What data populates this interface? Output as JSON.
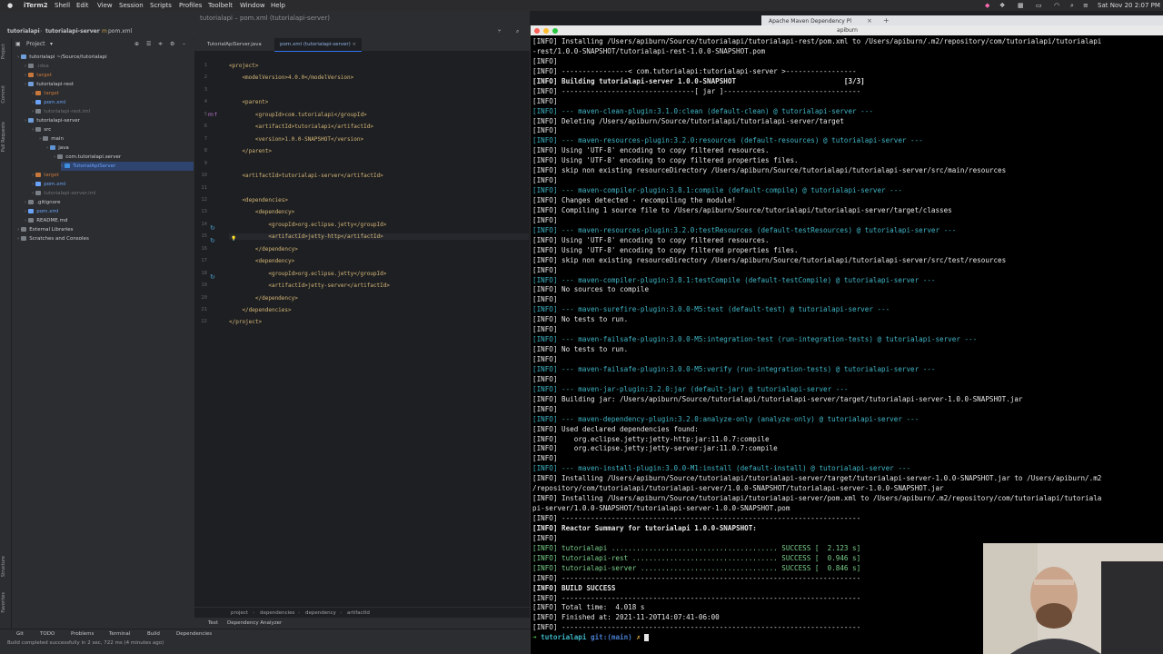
{
  "menubar": {
    "app": "iTerm2",
    "items": [
      "Shell",
      "Edit",
      "View",
      "Session",
      "Scripts",
      "Profiles",
      "Toolbelt",
      "Window",
      "Help"
    ],
    "clock": "Sat Nov 20  2:07 PM"
  },
  "ide": {
    "window_title": "tutorialapi – pom.xml (tutorialapi-server)",
    "breadcrumb": [
      "tutorialapi",
      "tutorialapi-server",
      "pom.xml"
    ],
    "project_label": "Project",
    "tree": [
      {
        "label": "tutorialapi ~/Source/tutorialapi",
        "indent": 0,
        "color": "#c9ccd1",
        "icon": "#6f9ed8"
      },
      {
        "label": ".idea",
        "indent": 1,
        "color": "#6e7278",
        "icon": "#7a7e85"
      },
      {
        "label": "target",
        "indent": 1,
        "color": "#c7773b",
        "icon": "#c7773b"
      },
      {
        "label": "tutorialapi-rest",
        "indent": 1,
        "color": "#c9ccd1",
        "icon": "#6f9ed8"
      },
      {
        "label": "target",
        "indent": 2,
        "color": "#c7773b",
        "icon": "#c7773b"
      },
      {
        "label": "pom.xml",
        "indent": 2,
        "color": "#6aa3f8",
        "icon": "#6aa3f8"
      },
      {
        "label": "tutorialapi-rest.iml",
        "indent": 2,
        "color": "#6e7278",
        "icon": "#7a7e85"
      },
      {
        "label": "tutorialapi-server",
        "indent": 1,
        "color": "#c9ccd1",
        "icon": "#6f9ed8"
      },
      {
        "label": "src",
        "indent": 2,
        "color": "#c9ccd1",
        "icon": "#7a7e85"
      },
      {
        "label": "main",
        "indent": 3,
        "color": "#c9ccd1",
        "icon": "#7a7e85"
      },
      {
        "label": "java",
        "indent": 4,
        "color": "#c9ccd1",
        "icon": "#5f93d1"
      },
      {
        "label": "com.tutorialapi.server",
        "indent": 5,
        "color": "#c9ccd1",
        "icon": "#7a7e85"
      },
      {
        "label": "TutorialApiServer",
        "indent": 6,
        "color": "#6aa3f8",
        "icon": "#3f8fe0"
      },
      {
        "label": "target",
        "indent": 2,
        "color": "#c7773b",
        "icon": "#c7773b"
      },
      {
        "label": "pom.xml",
        "indent": 2,
        "color": "#6aa3f8",
        "icon": "#6aa3f8"
      },
      {
        "label": "tutorialapi-server.iml",
        "indent": 2,
        "color": "#6e7278",
        "icon": "#7a7e85"
      },
      {
        "label": ".gitignore",
        "indent": 1,
        "color": "#c9ccd1",
        "icon": "#7a7e85"
      },
      {
        "label": "pom.xml",
        "indent": 1,
        "color": "#6aa3f8",
        "icon": "#6aa3f8"
      },
      {
        "label": "README.md",
        "indent": 1,
        "color": "#c9ccd1",
        "icon": "#7a7e85"
      },
      {
        "label": "External Libraries",
        "indent": 0,
        "color": "#c9ccd1",
        "icon": "#7a7e85"
      },
      {
        "label": "Scratches and Consoles",
        "indent": 0,
        "color": "#c9ccd1",
        "icon": "#7a7e85"
      }
    ],
    "tabs": [
      "TutorialApiServer.java",
      "pom.xml (tutorialapi-server)"
    ],
    "line_numbers": [
      "1",
      "2",
      "3",
      "4",
      "5",
      "6",
      "7",
      "8",
      "9",
      "10",
      "11",
      "12",
      "13",
      "14",
      "15",
      "16",
      "17",
      "18",
      "19",
      "20",
      "21",
      "22"
    ],
    "code": [
      "<project>",
      "    <modelVersion>4.0.0</modelVersion>",
      "",
      "    <parent>",
      "        <groupId>com.tutorialapi</groupId>",
      "        <artifactId>tutorialapi</artifactId>",
      "        <version>1.0.0-SNAPSHOT</version>",
      "    </parent>",
      "",
      "    <artifactId>tutorialapi-server</artifactId>",
      "",
      "    <dependencies>",
      "        <dependency>",
      "            <groupId>org.eclipse.jetty</groupId>",
      "            <artifactId>jetty-http</artifactId>",
      "        </dependency>",
      "        <dependency>",
      "            <groupId>org.eclipse.jetty</groupId>",
      "            <artifactId>jetty-server</artifactId>",
      "        </dependency>",
      "    </dependencies>",
      "</project>"
    ],
    "editor_breadcrumb": [
      "project",
      "dependencies",
      "dependency",
      "artifactId"
    ],
    "editor_subtabs": [
      "Text",
      "Dependency Analyzer"
    ],
    "bottom_tools": [
      "Git",
      "TODO",
      "Problems",
      "Terminal",
      "Build",
      "Dependencies"
    ],
    "status": "Build completed successfully in 2 sec, 722 ms (4 minutes ago)"
  },
  "browser": {
    "tab_title": "Apache Maven Dependency Pl"
  },
  "terminal": {
    "title": "apiburn",
    "lines": [
      "[INFO] Installing /Users/apiburn/Source/tutorialapi/tutorialapi-rest/pom.xml to /Users/apiburn/.m2/repository/com/tutorialapi/tutorialapi",
      "-rest/1.0.0-SNAPSHOT/tutorialapi-rest-1.0.0-SNAPSHOT.pom",
      "[INFO]",
      "[INFO] ----------------< com.tutorialapi:tutorialapi-server >-----------------",
      "[INFO] Building tutorialapi-server 1.0.0-SNAPSHOT                          [3/3]",
      "[INFO] --------------------------------[ jar ]---------------------------------",
      "[INFO]",
      "[INFO] --- maven-clean-plugin:3.1.0:clean (default-clean) @ tutorialapi-server ---",
      "[INFO] Deleting /Users/apiburn/Source/tutorialapi/tutorialapi-server/target",
      "[INFO]",
      "[INFO] --- maven-resources-plugin:3.2.0:resources (default-resources) @ tutorialapi-server ---",
      "[INFO] Using 'UTF-8' encoding to copy filtered resources.",
      "[INFO] Using 'UTF-8' encoding to copy filtered properties files.",
      "[INFO] skip non existing resourceDirectory /Users/apiburn/Source/tutorialapi/tutorialapi-server/src/main/resources",
      "[INFO]",
      "[INFO] --- maven-compiler-plugin:3.8.1:compile (default-compile) @ tutorialapi-server ---",
      "[INFO] Changes detected - recompiling the module!",
      "[INFO] Compiling 1 source file to /Users/apiburn/Source/tutorialapi/tutorialapi-server/target/classes",
      "[INFO]",
      "[INFO] --- maven-resources-plugin:3.2.0:testResources (default-testResources) @ tutorialapi-server ---",
      "[INFO] Using 'UTF-8' encoding to copy filtered resources.",
      "[INFO] Using 'UTF-8' encoding to copy filtered properties files.",
      "[INFO] skip non existing resourceDirectory /Users/apiburn/Source/tutorialapi/tutorialapi-server/src/test/resources",
      "[INFO]",
      "[INFO] --- maven-compiler-plugin:3.8.1:testCompile (default-testCompile) @ tutorialapi-server ---",
      "[INFO] No sources to compile",
      "[INFO]",
      "[INFO] --- maven-surefire-plugin:3.0.0-M5:test (default-test) @ tutorialapi-server ---",
      "[INFO] No tests to run.",
      "[INFO]",
      "[INFO] --- maven-failsafe-plugin:3.0.0-M5:integration-test (run-integration-tests) @ tutorialapi-server ---",
      "[INFO] No tests to run.",
      "[INFO]",
      "[INFO] --- maven-failsafe-plugin:3.0.0-M5:verify (run-integration-tests) @ tutorialapi-server ---",
      "[INFO]",
      "[INFO] --- maven-jar-plugin:3.2.0:jar (default-jar) @ tutorialapi-server ---",
      "[INFO] Building jar: /Users/apiburn/Source/tutorialapi/tutorialapi-server/target/tutorialapi-server-1.0.0-SNAPSHOT.jar",
      "[INFO]",
      "[INFO] --- maven-dependency-plugin:3.2.0:analyze-only (analyze-only) @ tutorialapi-server ---",
      "[INFO] Used declared dependencies found:",
      "[INFO]    org.eclipse.jetty:jetty-http:jar:11.0.7:compile",
      "[INFO]    org.eclipse.jetty:jetty-server:jar:11.0.7:compile",
      "[INFO]",
      "[INFO] --- maven-install-plugin:3.0.0-M1:install (default-install) @ tutorialapi-server ---",
      "[INFO] Installing /Users/apiburn/Source/tutorialapi/tutorialapi-server/target/tutorialapi-server-1.0.0-SNAPSHOT.jar to /Users/apiburn/.m2",
      "/repository/com/tutorialapi/tutorialapi-server/1.0.0-SNAPSHOT/tutorialapi-server-1.0.0-SNAPSHOT.jar",
      "[INFO] Installing /Users/apiburn/Source/tutorialapi/tutorialapi-server/pom.xml to /Users/apiburn/.m2/repository/com/tutorialapi/tutoriala",
      "pi-server/1.0.0-SNAPSHOT/tutorialapi-server-1.0.0-SNAPSHOT.pom",
      "[INFO] ------------------------------------------------------------------------",
      "[INFO] Reactor Summary for tutorialapi 1.0.0-SNAPSHOT:",
      "[INFO]",
      "[INFO] tutorialapi ........................................ SUCCESS [  2.123 s]",
      "[INFO] tutorialapi-rest ................................... SUCCESS [  0.946 s]",
      "[INFO] tutorialapi-server ................................. SUCCESS [  0.846 s]",
      "[INFO] ------------------------------------------------------------------------",
      "[INFO] BUILD SUCCESS",
      "[INFO] ------------------------------------------------------------------------",
      "[INFO] Total time:  4.018 s",
      "[INFO] Finished at: 2021-11-20T14:07:41-06:00",
      "[INFO] ------------------------------------------------------------------------"
    ],
    "prompt": {
      "arrow": "➜",
      "dir": "tutorialapi",
      "branch": "git:(main)",
      "mark": "✗"
    }
  }
}
